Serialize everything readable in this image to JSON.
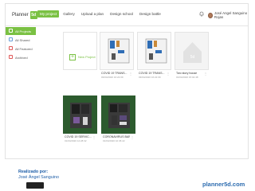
{
  "header": {
    "brand": "Planner",
    "brand_badge": "5d",
    "nav": [
      {
        "label": "My project",
        "active": true
      },
      {
        "label": "Gallery"
      },
      {
        "label": "Upload a plan"
      },
      {
        "label": "Design school"
      },
      {
        "label": "Design battle"
      }
    ],
    "user_name": "José Angel Sanguino Rojas",
    "accent": "#7ac143"
  },
  "sidebar": {
    "items": [
      {
        "label": "All Projects",
        "icon": "grid-icon",
        "active": true
      },
      {
        "label": "All Shared",
        "icon": "share-icon"
      },
      {
        "label": "All Featured",
        "icon": "star-icon"
      },
      {
        "label": "Archived",
        "icon": "trash-icon"
      }
    ]
  },
  "projects": {
    "new_label": "New Project",
    "cards": [
      {
        "title": "COVID 19 TRANS...",
        "sub": "03/04/2020 16:22:09"
      },
      {
        "title": "COVID 19 TRANS...",
        "sub": "03/04/2020 16:22:09"
      },
      {
        "title": "Two story house",
        "sub": "01/04/2020 15:02:48"
      },
      {
        "title": "COVID 19 SERVIC...",
        "sub": "01/04/2020 12:28:32"
      },
      {
        "title": "CORONAVIRUS BAÑO",
        "sub": "01/04/2020 10:45:22"
      }
    ]
  },
  "footer": {
    "credit_line1": "Realizado por:",
    "credit_line2": "José Ángel Sanguino",
    "site": "planner5d.com"
  }
}
